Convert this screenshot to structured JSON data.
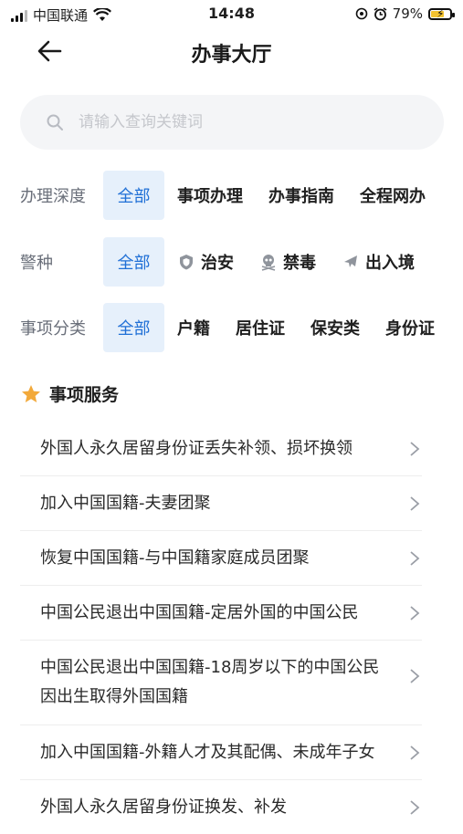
{
  "status_bar": {
    "carrier": "中国联通",
    "time": "14:48",
    "battery_percent": "79%",
    "battery_level": 0.79
  },
  "nav": {
    "title": "办事大厅"
  },
  "search": {
    "placeholder": "请输入查询关键词"
  },
  "filters": [
    {
      "label": "办理深度",
      "chips": [
        {
          "label": "全部",
          "active": true
        },
        {
          "label": "事项办理"
        },
        {
          "label": "办事指南"
        },
        {
          "label": "全程网办"
        }
      ]
    },
    {
      "label": "警种",
      "chips": [
        {
          "label": "全部",
          "active": true
        },
        {
          "label": "治安",
          "icon": "shield-icon"
        },
        {
          "label": "禁毒",
          "icon": "skull-icon"
        },
        {
          "label": "出入境",
          "icon": "airplane-icon"
        }
      ]
    },
    {
      "label": "事项分类",
      "chips": [
        {
          "label": "全部",
          "active": true
        },
        {
          "label": "户籍"
        },
        {
          "label": "居住证"
        },
        {
          "label": "保安类"
        },
        {
          "label": "身份证"
        }
      ]
    }
  ],
  "section": {
    "title": "事项服务"
  },
  "items": [
    {
      "text": "外国人永久居留身份证丢失补领、损坏换领"
    },
    {
      "text": "加入中国国籍-夫妻团聚"
    },
    {
      "text": "恢复中国国籍-与中国籍家庭成员团聚"
    },
    {
      "text": "中国公民退出中国国籍-定居外国的中国公民"
    },
    {
      "text": "中国公民退出中国国籍-18周岁以下的中国公民因出生取得外国国籍"
    },
    {
      "text": "加入中国国籍-外籍人才及其配偶、未成年子女"
    },
    {
      "text": "外国人永久居留身份证换发、补发"
    }
  ],
  "colors": {
    "accent": "#1f6fd6",
    "chip_active_bg": "#e6f0fb",
    "star": "#f2a93b",
    "label_gray": "#6a6f7a"
  }
}
